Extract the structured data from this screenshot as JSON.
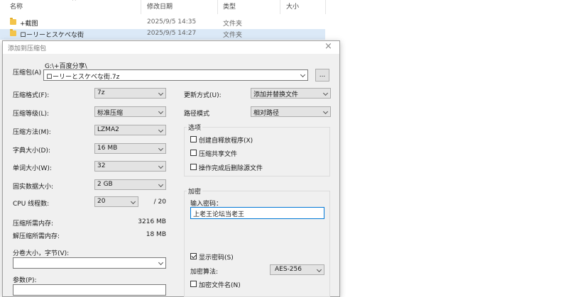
{
  "explorer": {
    "columns": {
      "name": "名称",
      "date": "修改日期",
      "type": "类型",
      "size": "大小"
    },
    "sort_arrow": "^",
    "files": [
      {
        "name": "+截图",
        "date": "2025/9/5 14:35",
        "type": "文件夹"
      },
      {
        "name": "ローリーとスケべな街",
        "date": "2025/9/5 14:27",
        "type": "文件夹"
      }
    ]
  },
  "dialog": {
    "title": "添加到压缩包",
    "close_glyph": "×",
    "archive_label": "压缩包(A)",
    "archive_path": "G:\\+百度分享\\",
    "archive_name": "ローリーとスケべな街.7z",
    "browse_label": "...",
    "format_label": "压缩格式(F):",
    "format_value": "7z",
    "level_label": "压缩等级(L):",
    "level_value": "标准压缩",
    "method_label": "压缩方法(M):",
    "method_value": "LZMA2",
    "dict_label": "字典大小(D):",
    "dict_value": "16 MB",
    "word_label": "单词大小(W):",
    "word_value": "32",
    "solid_label": "固实数据大小:",
    "solid_value": "2 GB",
    "threads_label": "CPU 线程数:",
    "threads_value": "20",
    "threads_max": "/ 20",
    "mem_comp_label": "压缩所需内存:",
    "mem_comp_value": "3216 MB",
    "mem_decomp_label": "解压缩所需内存:",
    "mem_decomp_value": "18 MB",
    "split_label": "分卷大小，字节(V):",
    "split_value": "",
    "params_label": "参数(P):",
    "update_label": "更新方式(U):",
    "update_value": "添加并替换文件",
    "path_mode_label": "路径模式",
    "path_mode_value": "相对路径",
    "options_title": "选项",
    "options": [
      {
        "label": "创建自释放程序(X)",
        "checked": false
      },
      {
        "label": "压缩共享文件",
        "checked": false
      },
      {
        "label": "操作完成后删除源文件",
        "checked": false
      }
    ],
    "encryption_title": "加密",
    "password_label": "输入密码：",
    "password_value": "上老王论坛当老王",
    "show_password_label": "显示密码(S)",
    "show_password_checked": true,
    "enc_method_label": "加密算法:",
    "enc_method_value": "AES-256",
    "enc_filenames_label": "加密文件名(N)",
    "enc_filenames_checked": false
  }
}
